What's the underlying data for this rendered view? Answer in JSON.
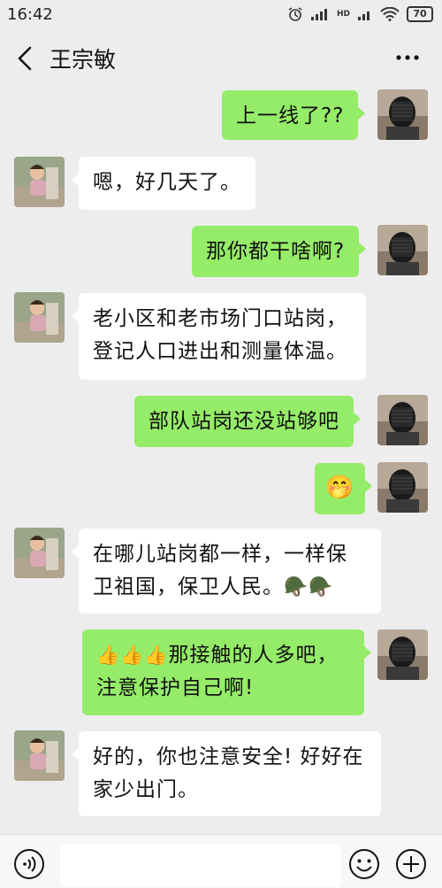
{
  "status": {
    "time": "16:42",
    "network": "HD",
    "battery": "70"
  },
  "header": {
    "title": "王宗敏"
  },
  "messages": [
    {
      "side": "out",
      "text": "上一线了??"
    },
    {
      "side": "in",
      "text": "嗯，好几天了。"
    },
    {
      "side": "out",
      "text": "那你都干啥啊?"
    },
    {
      "side": "in",
      "lines": [
        "老小区和老市场门口站岗，",
        "登记人口进出和测量体温。"
      ]
    },
    {
      "side": "out",
      "text": "部队站岗还没站够吧"
    },
    {
      "side": "out",
      "emoji": "🤭"
    },
    {
      "side": "in",
      "lines": [
        "在哪儿站岗都一样，一样保",
        "卫祖国，保卫人民。"
      ],
      "emoji": "🪖🪖"
    },
    {
      "side": "out",
      "emoji": "👍👍👍",
      "lines": [
        "那接触的人多吧，",
        "注意保护自己啊!"
      ]
    },
    {
      "side": "in",
      "lines": [
        "好的，你也注意安全! 好好在",
        "家少出门。"
      ]
    }
  ],
  "icons": {
    "back": "back-arrow-icon",
    "more": "more-icon",
    "voice": "voice-icon",
    "emoji": "emoji-icon",
    "add": "plus-icon"
  },
  "colors": {
    "background": "#ededed",
    "outgoing_bubble": "#95ec69",
    "incoming_bubble": "#ffffff"
  }
}
